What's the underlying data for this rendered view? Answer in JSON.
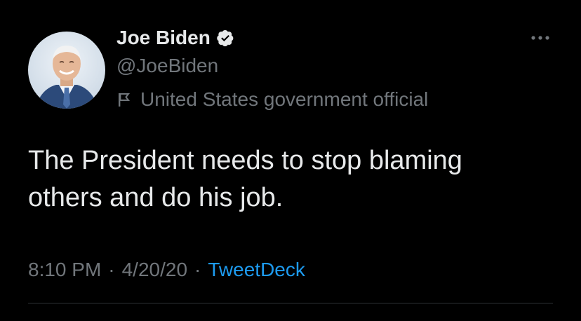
{
  "tweet": {
    "author": {
      "display_name": "Joe Biden",
      "handle": "@JoeBiden",
      "label": "United States government official",
      "verified": true,
      "avatar_alt": "Profile photo"
    },
    "text_line1": "The President needs to stop blaming",
    "text_line2": "others and do his job.",
    "time": "8:10 PM",
    "date": "4/20/20",
    "separator": "·",
    "source": "TweetDeck"
  },
  "icons": {
    "verified": "verified-badge-icon",
    "label": "flag-icon",
    "more": "more-options-icon"
  },
  "colors": {
    "background": "#000000",
    "primary_text": "#e7e9ea",
    "secondary_text": "#71767b",
    "accent": "#1d9bf0",
    "divider": "#2f3336"
  }
}
